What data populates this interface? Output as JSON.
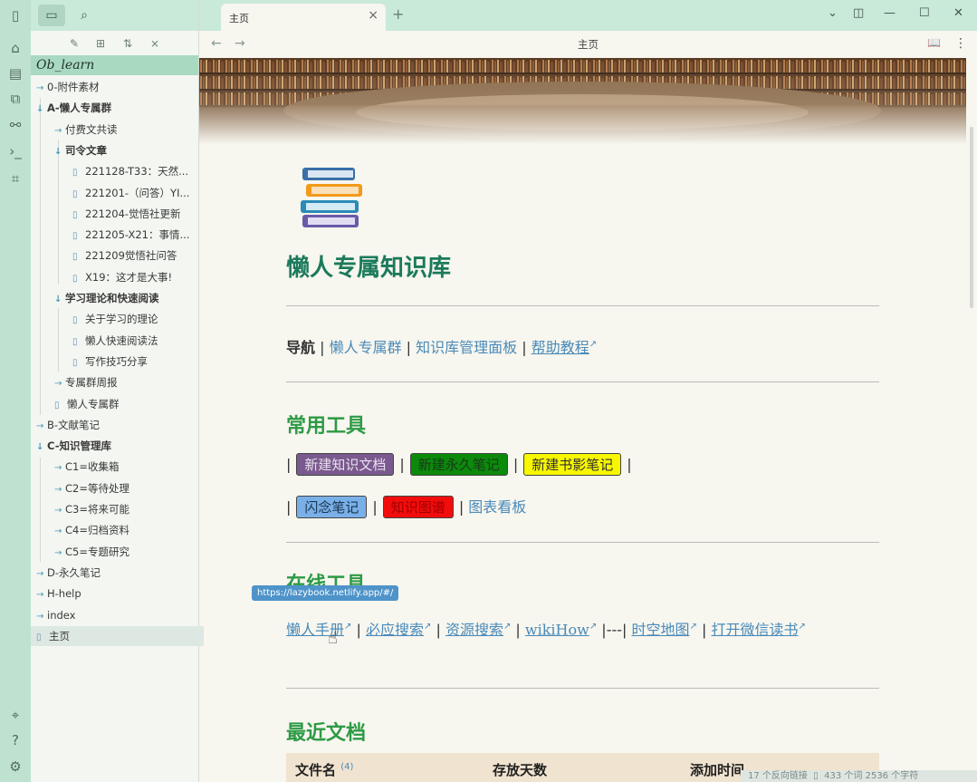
{
  "tab": {
    "title": "主页",
    "close": "×",
    "new": "+"
  },
  "nav": {
    "back": "←",
    "forward": "→",
    "title": "主页",
    "reading": "📖",
    "more": "⋮"
  },
  "vault": {
    "name": "Ob_learn"
  },
  "tree": [
    {
      "label": "0-附件素材",
      "arrow": "→",
      "bold": false
    },
    {
      "label": "A-懒人专属群",
      "arrow": "↓",
      "bold": true
    },
    {
      "label": "付费文共读",
      "arrow": "→",
      "bold": false
    },
    {
      "label": "司令文章",
      "arrow": "↓",
      "bold": true
    },
    {
      "label": "221128-T33：天然...",
      "arrow": "",
      "bold": false
    },
    {
      "label": "221201-（问答）YI...",
      "arrow": "",
      "bold": false
    },
    {
      "label": "221204-觉悟社更新",
      "arrow": "",
      "bold": false
    },
    {
      "label": "221205-X21：事情...",
      "arrow": "",
      "bold": false
    },
    {
      "label": "221209觉悟社问答",
      "arrow": "",
      "bold": false
    },
    {
      "label": "X19：这才是大事!",
      "arrow": "",
      "bold": false
    },
    {
      "label": "学习理论和快速阅读",
      "arrow": "↓",
      "bold": true
    },
    {
      "label": "关于学习的理论",
      "arrow": "",
      "bold": false
    },
    {
      "label": "懒人快速阅读法",
      "arrow": "",
      "bold": false
    },
    {
      "label": "写作技巧分享",
      "arrow": "",
      "bold": false
    },
    {
      "label": "专属群周报",
      "arrow": "→",
      "bold": false
    },
    {
      "label": "懒人专属群",
      "arrow": "",
      "bold": false
    },
    {
      "label": "B-文献笔记",
      "arrow": "→",
      "bold": false
    },
    {
      "label": "C-知识管理库",
      "arrow": "↓",
      "bold": true
    },
    {
      "label": "C1=收集箱",
      "arrow": "→",
      "bold": false
    },
    {
      "label": "C2=等待处理",
      "arrow": "→",
      "bold": false
    },
    {
      "label": "C3=将来可能",
      "arrow": "→",
      "bold": false
    },
    {
      "label": "C4=归档资料",
      "arrow": "→",
      "bold": false
    },
    {
      "label": "C5=专题研究",
      "arrow": "→",
      "bold": false
    },
    {
      "label": "D-永久笔记",
      "arrow": "→",
      "bold": false
    },
    {
      "label": "H-help",
      "arrow": "→",
      "bold": false
    },
    {
      "label": "index",
      "arrow": "→",
      "bold": false
    },
    {
      "label": "主页",
      "arrow": "",
      "bold": false
    }
  ],
  "page": {
    "title": "懒人专属知识库",
    "nav_label": "导航",
    "nav_links": [
      "懒人专属群",
      "知识库管理面板",
      "帮助教程"
    ],
    "tools_heading": "常用工具",
    "tools_row1": [
      {
        "label": "新建知识文档",
        "bg": "#7a5a8e",
        "fg": "#e8e0f0"
      },
      {
        "label": "新建永久笔记",
        "bg": "#0b8a0b",
        "fg": "#1a3a1a"
      },
      {
        "label": "新建书影笔记",
        "bg": "#f7f700",
        "fg": "#333333"
      }
    ],
    "tools_row2": [
      {
        "label": "闪念笔记",
        "bg": "#7ab0e8",
        "fg": "#1a3550"
      },
      {
        "label": "知识图谱",
        "bg": "#f20c0c",
        "fg": "#a00000"
      }
    ],
    "chart_link": "图表看板",
    "online_heading": "在线工具",
    "tooltip": "https://lazybook.netlify.app/#/",
    "online_links": [
      "懒人手册",
      "必应搜索",
      "资源搜索",
      "wikiHow",
      "时空地图",
      "打开微信读书"
    ],
    "online_sep": "|---|",
    "recent_heading": "最近文档",
    "table_headers": [
      "文件名",
      "存放天数",
      "添加时间"
    ],
    "table_count": "(4)"
  },
  "status": {
    "backlinks": "17 个反向链接",
    "words": "433 个词",
    "chars": "2536 个字符"
  },
  "colors": {
    "accent": "#1b7a5b",
    "heading": "#2d9a45",
    "link": "#4a8ab8",
    "ribbon": "#bfe2d0"
  }
}
